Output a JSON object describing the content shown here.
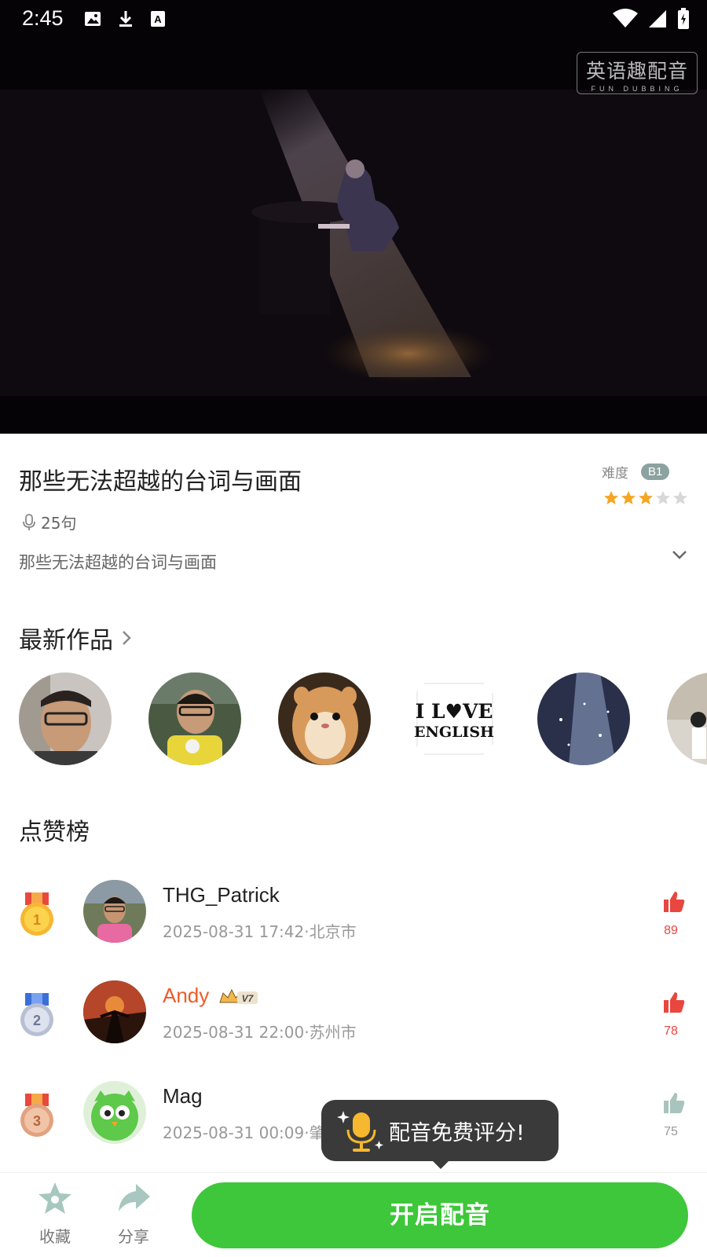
{
  "status_bar": {
    "time": "2:45"
  },
  "video": {
    "logo_cn": "英语趣配音",
    "logo_en": "FUN DUBBING"
  },
  "info": {
    "title": "那些无法超越的台词与画面",
    "difficulty_label": "难度",
    "difficulty_level": "B1",
    "stars_filled": 3,
    "stars_total": 5,
    "sentence_count": "25句",
    "description": "那些无法超越的台词与画面"
  },
  "latest_works": {
    "title": "最新作品"
  },
  "ranking": {
    "title": "点赞榜",
    "items": [
      {
        "rank": "1",
        "name": "THG_Patrick",
        "meta": "2025-08-31 17:42·北京市",
        "likes": "89",
        "liked": true,
        "vip": ""
      },
      {
        "rank": "2",
        "name": "Andy",
        "meta": "2025-08-31 22:00·苏州市",
        "likes": "78",
        "liked": true,
        "vip": "V7"
      },
      {
        "rank": "3",
        "name": "Mag",
        "meta": "2025-08-31 00:09·肇庆市",
        "likes": "75",
        "liked": false,
        "vip": ""
      }
    ]
  },
  "tooltip": {
    "text": "配音免费评分!"
  },
  "bottom_bar": {
    "favorite_label": "收藏",
    "share_label": "分享",
    "start_label": "开启配音"
  },
  "colors": {
    "accent_green": "#3ec73a",
    "like_red": "#e8463f",
    "star_orange": "#f5a623",
    "vip_orange": "#f05a28"
  }
}
